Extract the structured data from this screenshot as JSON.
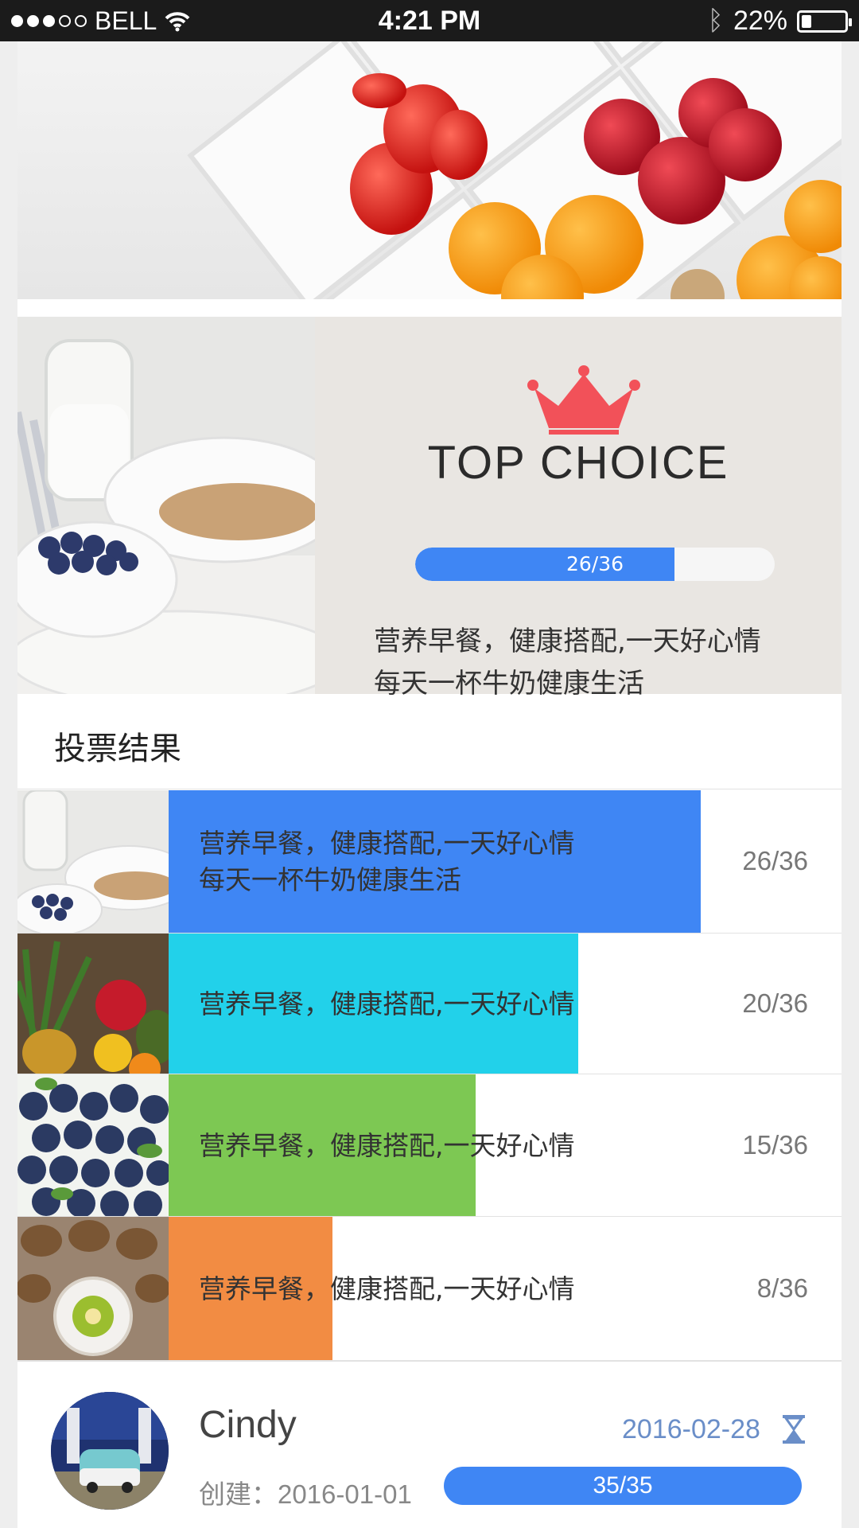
{
  "status_bar": {
    "carrier": "BELL",
    "time": "4:21 PM",
    "battery": "22%",
    "battery_level": 0.22
  },
  "top_choice": {
    "title": "TOP CHOICE",
    "progress_label": "26/36",
    "progress": 0.722,
    "desc_line1": "营养早餐，健康搭配,一天好心情",
    "desc_line2": "每天一杯牛奶健康生活",
    "crown_color": "#f25159"
  },
  "vote": {
    "heading": "投票结果",
    "items": [
      {
        "line1": "营养早餐，健康搭配,一天好心情",
        "line2": "每天一杯牛奶健康生活",
        "count": "26/36",
        "fraction": 0.722,
        "color": "#3f86f4",
        "image": "milk-cereal"
      },
      {
        "line1": "营养早餐，健康搭配,一天好心情",
        "line2": "",
        "count": "20/36",
        "fraction": 0.556,
        "color": "#22d1ea",
        "image": "fruits"
      },
      {
        "line1": "营养早餐，健康搭配,一天好心情",
        "line2": "",
        "count": "15/36",
        "fraction": 0.417,
        "color": "#7dc853",
        "image": "blueberries"
      },
      {
        "line1": "营养早餐，健康搭配,一天好心情",
        "line2": "",
        "count": "8/36",
        "fraction": 0.222,
        "color": "#f28c43",
        "image": "kiwis"
      }
    ]
  },
  "footer": {
    "name": "Cindy",
    "end_date": "2016-02-28",
    "created_label": "创建：",
    "created_date": "2016-01-01",
    "progress_label": "35/35",
    "icons": [
      "hourglass-icon"
    ]
  }
}
